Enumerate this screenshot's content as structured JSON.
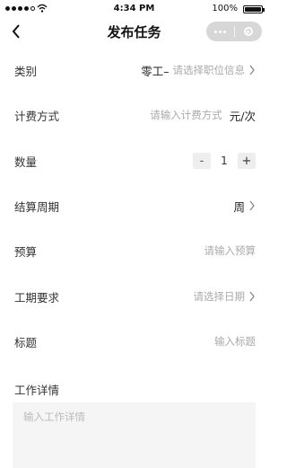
{
  "status_bar": {
    "time": "4:34 PM",
    "battery": "100%"
  },
  "nav": {
    "title": "发布任务"
  },
  "form": {
    "category": {
      "label": "类别",
      "value": "零工–",
      "placeholder": "请选择职位信息"
    },
    "billing": {
      "label": "计费方式",
      "placeholder": "请输入计费方式",
      "unit": "元/次"
    },
    "quantity": {
      "label": "数量",
      "minus": "-",
      "value": "1",
      "plus": "+"
    },
    "settlement": {
      "label": "结算周期",
      "value": "周"
    },
    "budget": {
      "label": "预算",
      "placeholder": "请输入预算"
    },
    "duration": {
      "label": "工期要求",
      "placeholder": "请选择日期"
    },
    "title": {
      "label": "标题",
      "placeholder": "输入标题"
    },
    "details": {
      "label": "工作详情",
      "placeholder": "输入工作详情"
    }
  }
}
